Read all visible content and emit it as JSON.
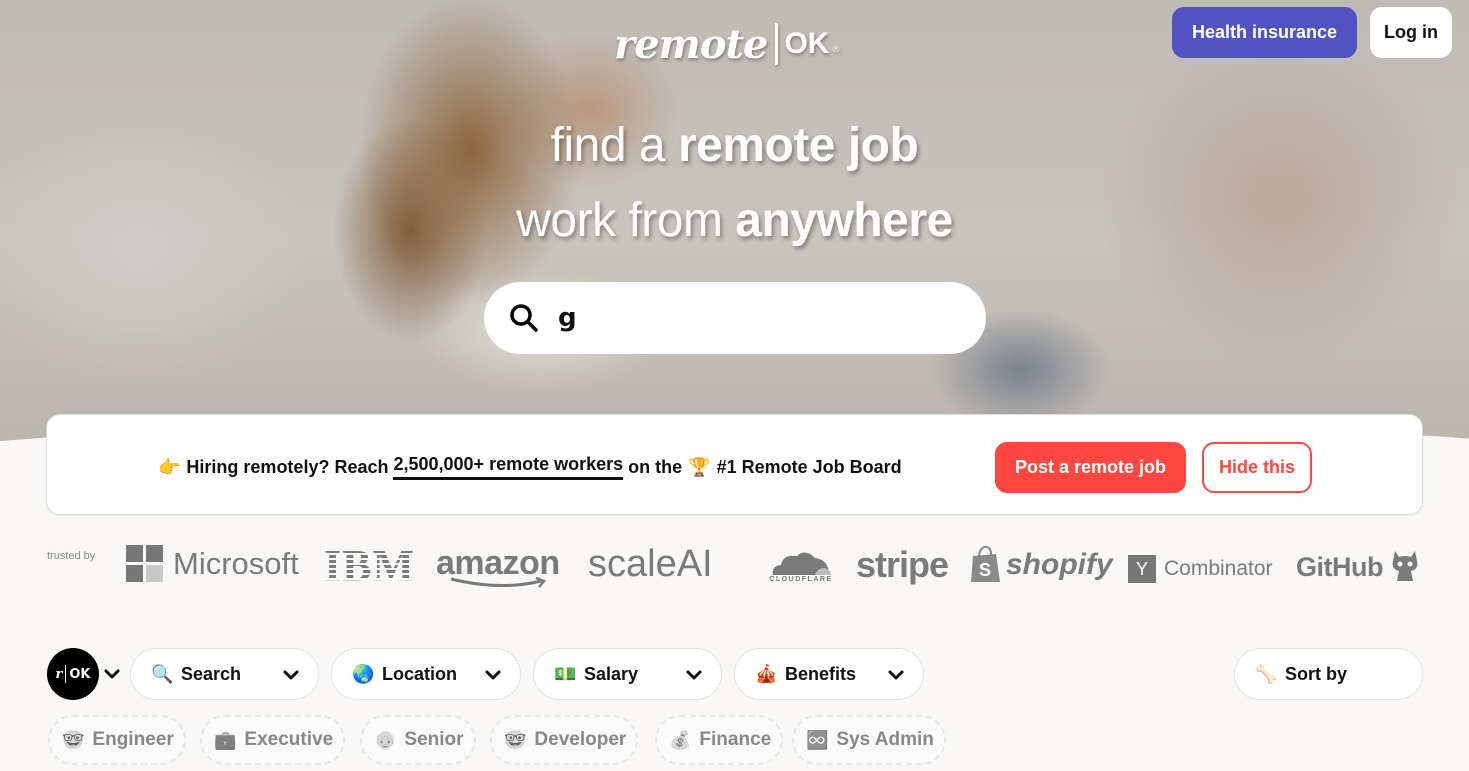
{
  "header": {
    "logo": {
      "remote": "remote",
      "ok": "OK",
      "reg": "®"
    },
    "health_insurance_label": "Health insurance",
    "login_label": "Log in",
    "colors": {
      "health_bg": "#5352c4",
      "accent_red": "#ff4742"
    }
  },
  "hero": {
    "line1_regular": "find a ",
    "line1_bold": "remote job",
    "line2_regular": "work from ",
    "line2_bold": "anywhere",
    "search": {
      "value": "g",
      "icon": "search-icon"
    }
  },
  "banner": {
    "pointer_emoji": "👉",
    "text_before": "Hiring remotely? Reach",
    "link_text": "2,500,000+ remote workers",
    "text_after": "on the",
    "trophy_emoji": "🏆",
    "text_end": "#1 Remote Job Board",
    "post_button": "Post a remote job",
    "hide_button": "Hide this"
  },
  "trusted": {
    "label": "trusted by",
    "brands": [
      "Microsoft",
      "IBM",
      "amazon",
      "scaleAI",
      "CLOUDFLARE",
      "stripe",
      "shopify",
      "Combinator",
      "GitHub"
    ],
    "yc_letter": "Y"
  },
  "filters": {
    "rok_logo": {
      "r": "r",
      "ok": "OK"
    },
    "items": [
      {
        "label": "Search",
        "icon": "🔍"
      },
      {
        "label": "Location",
        "icon": "🌏"
      },
      {
        "label": "Salary",
        "icon": "💵"
      },
      {
        "label": "Benefits",
        "icon": "🎪"
      }
    ],
    "sort": {
      "label": "Sort by",
      "icon": "🦴"
    }
  },
  "tags": [
    {
      "label": "Engineer",
      "icon": "🤓"
    },
    {
      "label": "Executive",
      "icon": "💼"
    },
    {
      "label": "Senior",
      "icon": "👴"
    },
    {
      "label": "Developer",
      "icon": "🤓"
    },
    {
      "label": "Finance",
      "icon": "💰"
    },
    {
      "label": "Sys Admin",
      "icon": "♾️"
    }
  ]
}
